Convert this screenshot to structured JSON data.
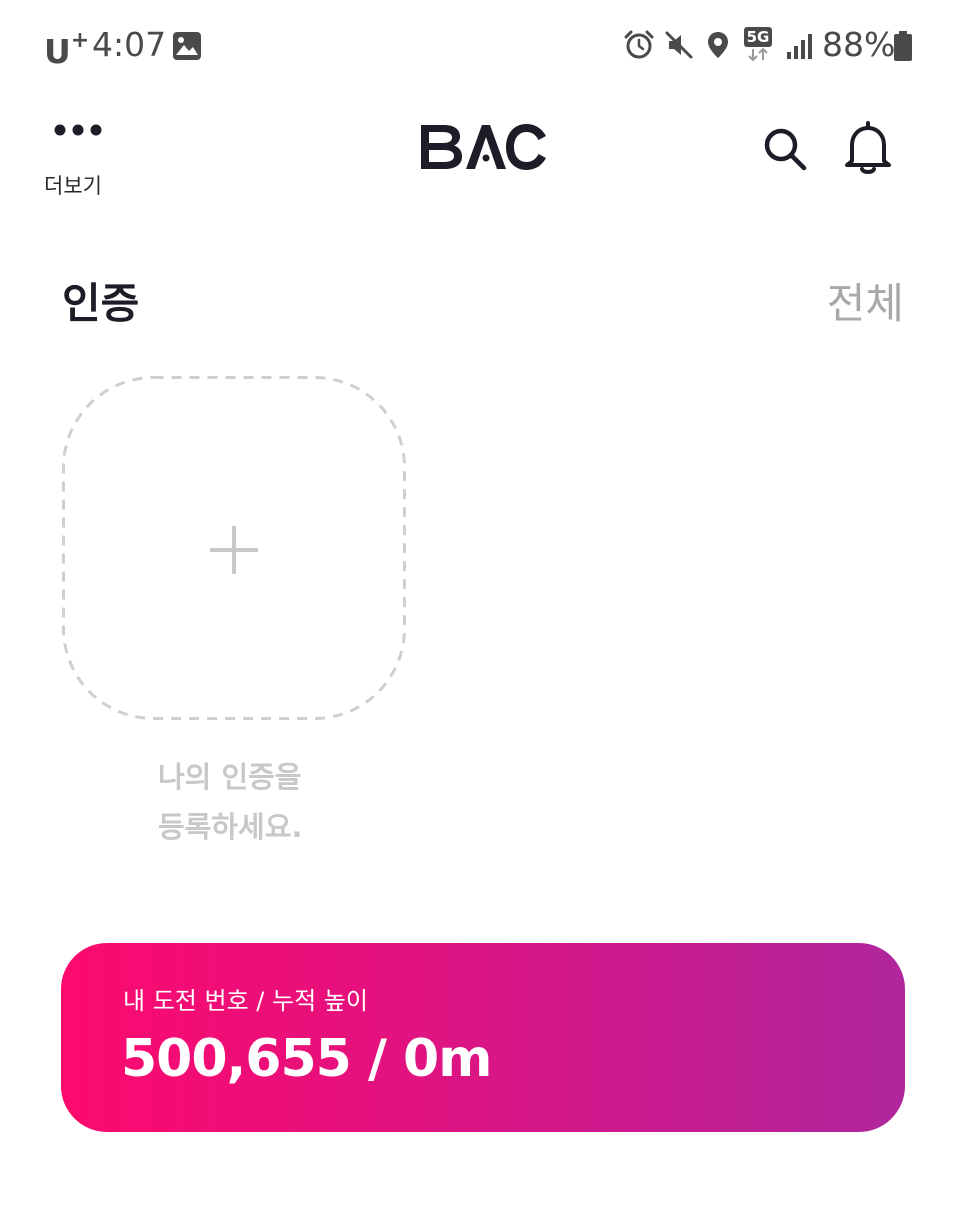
{
  "status_bar": {
    "carrier": "U",
    "carrier_plus": "+",
    "time": "4:07",
    "network_type": "5G",
    "battery_percent": "88%"
  },
  "app_bar": {
    "more_label": "더보기",
    "logo_text": "BAC",
    "icons": {
      "more": "more-dots-icon",
      "search": "search-icon",
      "notifications": "bell-icon"
    }
  },
  "certification": {
    "title": "인증",
    "view_all": "전체",
    "add_hint_line1": "나의 인증을",
    "add_hint_line2": "등록하세요."
  },
  "challenge": {
    "label": "내 도전 번호 / 누적 높이",
    "value": "500,655 / 0m"
  },
  "colors": {
    "text_dark": "#1d1d27",
    "text_muted": "#a8a8a8",
    "gradient_start": "#fc0a6e",
    "gradient_end": "#b0279d"
  }
}
